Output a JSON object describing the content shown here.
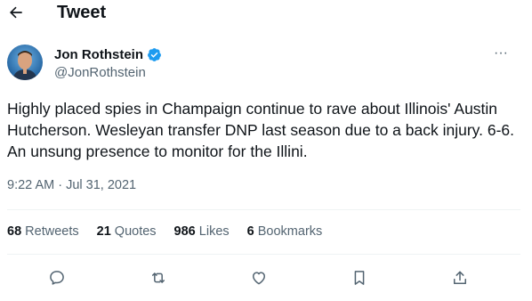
{
  "header": {
    "title": "Tweet",
    "back_icon": "back-arrow-icon"
  },
  "author": {
    "name": "Jon Rothstein",
    "handle": "@JonRothstein",
    "verified": true,
    "verified_color": "#1d9bf0"
  },
  "tweet": {
    "text": "Highly placed spies in Champaign continue to rave about Illinois' Austin Hutcherson. Wesleyan transfer DNP last season due to a back injury. 6-6. An unsung presence to monitor for the Illini.",
    "timestamp": "9:22 AM · Jul 31, 2021"
  },
  "stats": [
    {
      "count": "68",
      "label": "Retweets"
    },
    {
      "count": "21",
      "label": "Quotes"
    },
    {
      "count": "986",
      "label": "Likes"
    },
    {
      "count": "6",
      "label": "Bookmarks"
    }
  ],
  "actions": [
    "reply-icon",
    "retweet-icon",
    "like-icon",
    "bookmark-icon",
    "share-icon"
  ],
  "colors": {
    "text": "#0f1419",
    "secondary": "#536471",
    "divider": "#eff3f4",
    "accent": "#1d9bf0"
  }
}
